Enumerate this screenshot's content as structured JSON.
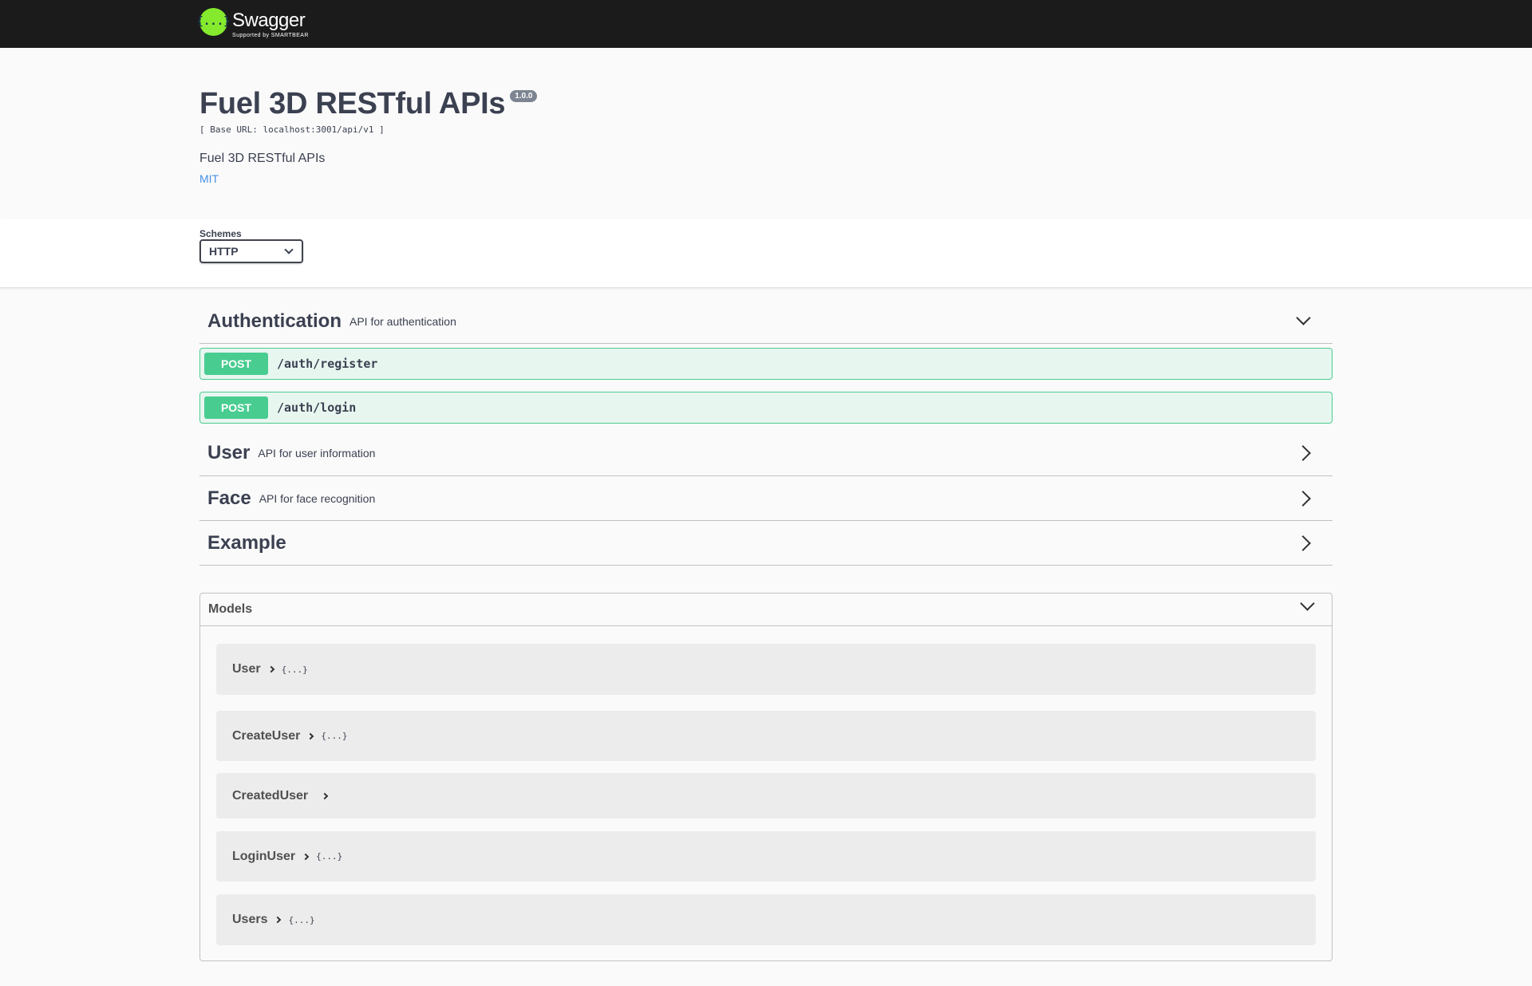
{
  "brand": {
    "logo_mark": "{...}",
    "name": "Swagger",
    "supported_by": "Supported by SMARTBEAR"
  },
  "info": {
    "title": "Fuel 3D RESTful APIs",
    "version": "1.0.0",
    "base_url": "[ Base URL: localhost:3001/api/v1 ]",
    "description": "Fuel 3D RESTful APIs",
    "license": "MIT"
  },
  "schemes": {
    "label": "Schemes",
    "selected": "HTTP"
  },
  "tags": [
    {
      "name": "Authentication",
      "description": "API for authentication",
      "expanded": true,
      "operations": [
        {
          "method": "POST",
          "path": "/auth/register"
        },
        {
          "method": "POST",
          "path": "/auth/login"
        }
      ]
    },
    {
      "name": "User",
      "description": "API for user information",
      "expanded": false
    },
    {
      "name": "Face",
      "description": "API for face recognition",
      "expanded": false
    },
    {
      "name": "Example",
      "description": "",
      "expanded": false
    }
  ],
  "models": {
    "title": "Models",
    "items": [
      {
        "name": "User",
        "brace": "{...}"
      },
      {
        "name": "CreateUser",
        "brace": "{...}"
      },
      {
        "name": "CreatedUser",
        "brace": ""
      },
      {
        "name": "LoginUser",
        "brace": "{...}"
      },
      {
        "name": "Users",
        "brace": "{...}"
      }
    ]
  },
  "colors": {
    "topbar": "#1b1b1b",
    "logo_green": "#85ea2d",
    "post_method": "#49cc90",
    "post_background": "#e8f6f0",
    "license_link": "#4990e2",
    "version_badge": "#7d8492"
  },
  "icons": {
    "scheme_dropdown": "chevron-down-icon",
    "tag_collapsed": "chevron-right-icon",
    "tag_expanded": "chevron-down-icon",
    "model_toggle": "chevron-right-icon"
  }
}
